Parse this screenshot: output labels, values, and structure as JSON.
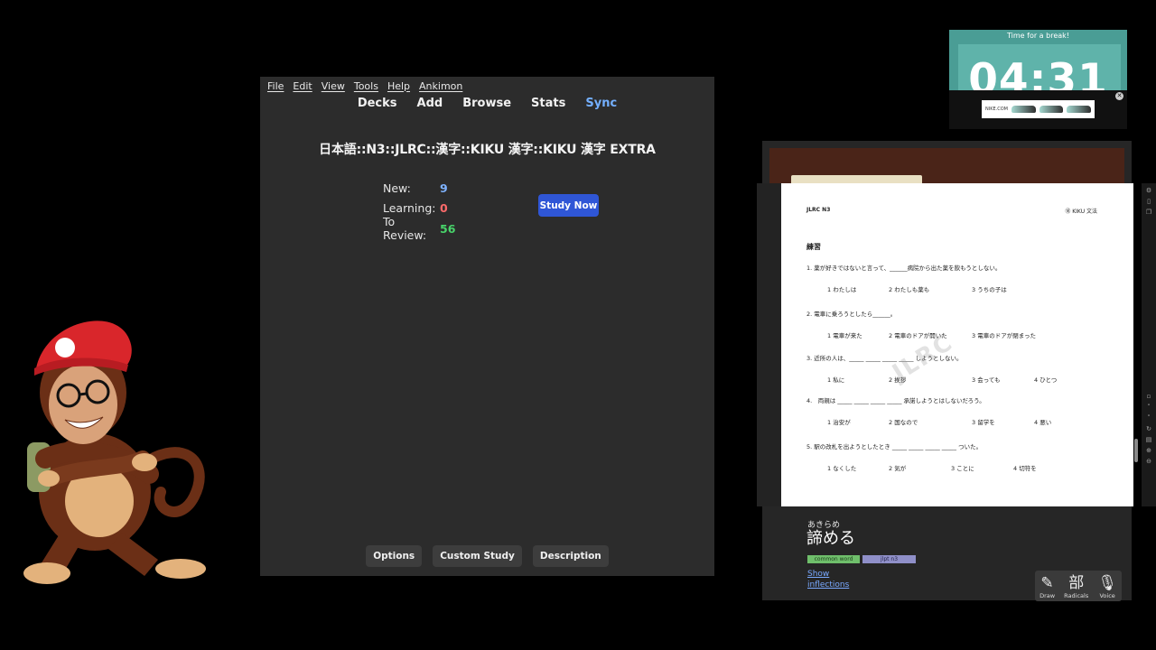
{
  "anki": {
    "menu": [
      "File",
      "Edit",
      "View",
      "Tools",
      "Help",
      "Ankimon"
    ],
    "nav": [
      "Decks",
      "Add",
      "Browse",
      "Stats",
      "Sync"
    ],
    "deck_title": "日本語::N3::JLRC::漢字::KIKU 漢字::KIKU 漢字 EXTRA",
    "stats": {
      "new_label": "New:",
      "new_value": "9",
      "learning_label": "Learning:",
      "learning_value": "0",
      "review_label": "To Review:",
      "review_value": "56"
    },
    "study_now": "Study Now",
    "bottom": [
      "Options",
      "Custom Study",
      "Description"
    ],
    "colors": {
      "new": "#7fb3ff",
      "learning": "#ff6b6b",
      "review": "#48d36a",
      "sync": "#74b0ff",
      "study_button": "#2f56d6"
    }
  },
  "timer": {
    "label": "Time for a break!",
    "time": "04:31",
    "ad_brand": "NIKE.COM",
    "close_icon": "close-icon"
  },
  "pdf": {
    "header_left": "JLRC N3",
    "header_right": "⑱ KIKU 文法",
    "section": "練習",
    "watermark": "JLRC",
    "questions": [
      {
        "text": "1. 薬が好きではないと言って、______病院から出た薬を飲もうとしない。",
        "options": [
          "1 わたしは",
          "2 わたしも薬も",
          "3 うちの子は"
        ]
      },
      {
        "text": "2. 電車に乗ろうとしたら______。",
        "options": [
          "1 電車が来た",
          "2 電車のドアが開いた",
          "3 電車のドアが閉まった"
        ]
      },
      {
        "text": "3. 近所の人は、_____ _____ _____ _____ しようとしない。",
        "options": [
          "1 私に",
          "2 挨拶",
          "3 会っても",
          "4 ひとつ"
        ]
      },
      {
        "text": "4.　両親は _____ _____ _____ _____ 承諾しようとはしないだろう。",
        "options": [
          "1 治安が",
          "2 国なので",
          "3 留学を",
          "4 悪い"
        ]
      },
      {
        "text": "5. 駅の改札を出ようとしたとき _____ _____ _____ _____ ついた。",
        "options": [
          "1 なくした",
          "2 気が",
          "3 ことに",
          "4 切符を"
        ]
      }
    ]
  },
  "dict": {
    "word_reading": "あきらめ",
    "word": "諦める",
    "tags": [
      "common word",
      "jlpt n3"
    ],
    "links": [
      "Show",
      "inflections"
    ],
    "tools": [
      {
        "label": "Draw",
        "glyph": "✎",
        "icon": "draw-icon"
      },
      {
        "label": "Radicals",
        "glyph": "部",
        "icon": "radicals-icon"
      },
      {
        "label": "Voice",
        "glyph": "🎙",
        "icon": "microphone-icon"
      }
    ]
  }
}
